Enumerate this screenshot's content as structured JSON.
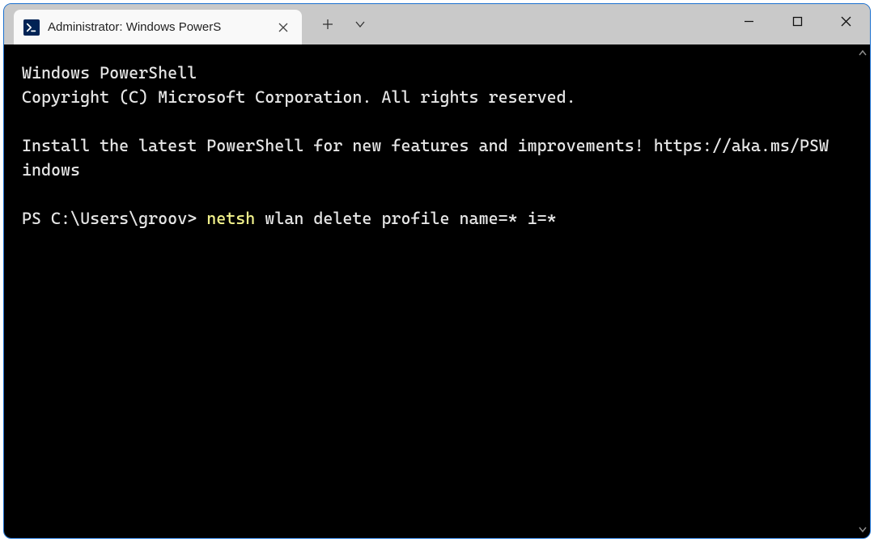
{
  "tab": {
    "title": "Administrator: Windows PowerS"
  },
  "terminal": {
    "line1": "Windows PowerShell",
    "line2": "Copyright (C) Microsoft Corporation. All rights reserved.",
    "line3": "Install the latest PowerShell for new features and improvements! https://aka.ms/PSWindows",
    "prompt": "PS C:\\Users\\groov> ",
    "cmd_highlight": "netsh",
    "cmd_rest": " wlan delete profile name=* i=*"
  }
}
